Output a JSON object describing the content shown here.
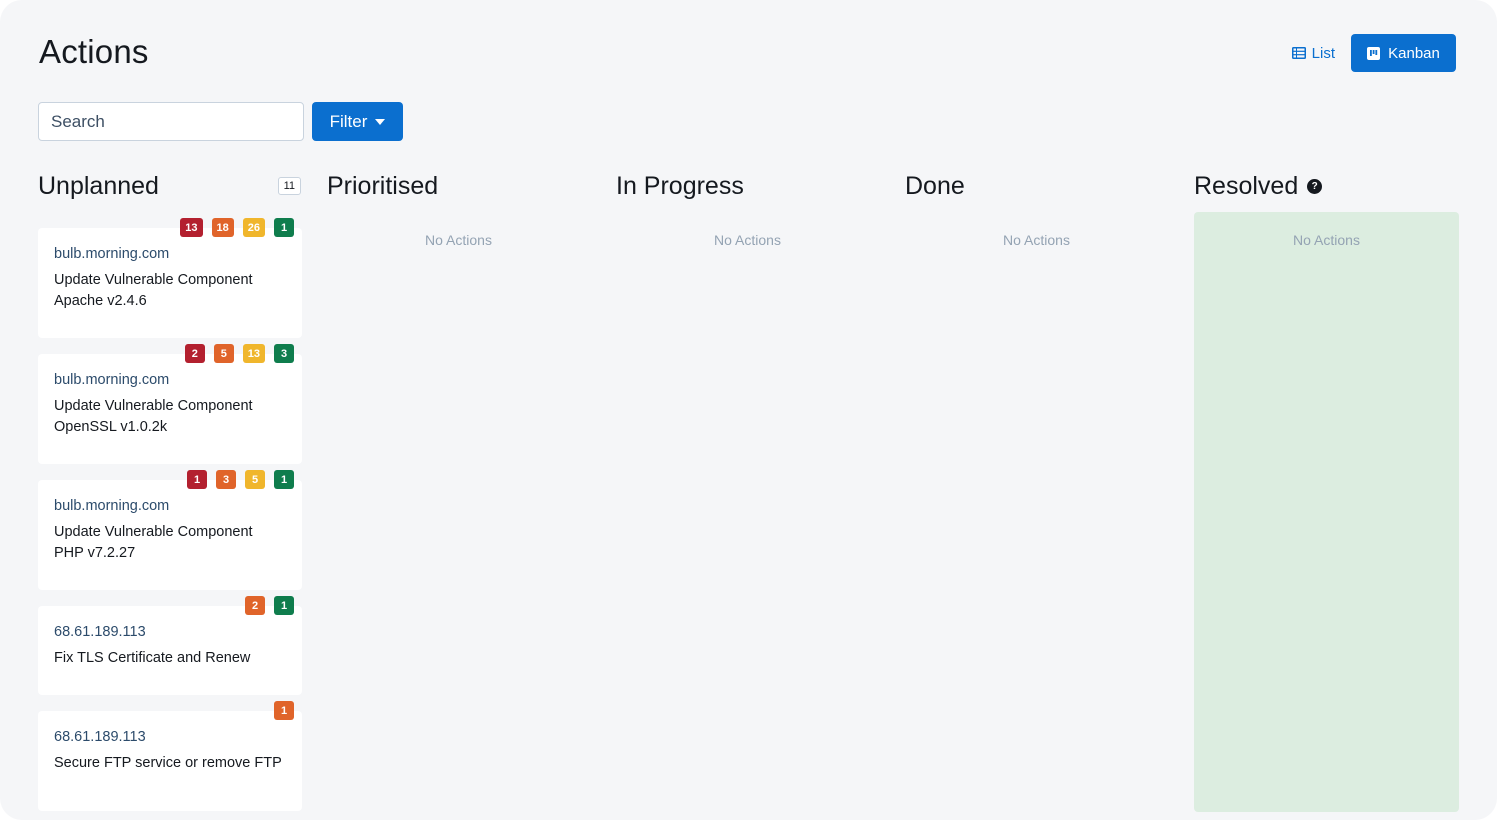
{
  "page": {
    "title": "Actions"
  },
  "view_switch": {
    "list_label": "List",
    "kanban_label": "Kanban",
    "active": "Kanban"
  },
  "toolbar": {
    "search_placeholder": "Search",
    "search_value": "",
    "filter_label": "Filter"
  },
  "colors": {
    "accent": "#0b6fcf",
    "critical": "#b3202f",
    "high": "#e0642a",
    "medium": "#f0b62c",
    "low": "#0f7d4d",
    "resolved_bg": "#dcede0"
  },
  "columns": [
    {
      "title": "Unplanned",
      "count": "11",
      "cards": [
        {
          "host": "bulb.morning.com",
          "title": "Update Vulnerable Component Apache v2.4.6",
          "badges": {
            "critical": "13",
            "high": "18",
            "medium": "26",
            "low": "1"
          }
        },
        {
          "host": "bulb.morning.com",
          "title": "Update Vulnerable Component OpenSSL v1.0.2k",
          "badges": {
            "critical": "2",
            "high": "5",
            "medium": "13",
            "low": "3"
          }
        },
        {
          "host": "bulb.morning.com",
          "title": "Update Vulnerable Component PHP v7.2.27",
          "badges": {
            "critical": "1",
            "high": "3",
            "medium": "5",
            "low": "1"
          }
        },
        {
          "host": "68.61.189.113",
          "title": "Fix TLS Certificate and Renew",
          "badges": {
            "high": "2",
            "low": "1"
          }
        },
        {
          "host": "68.61.189.113",
          "title": "Secure FTP service or remove FTP",
          "badges": {
            "high": "1"
          }
        }
      ]
    },
    {
      "title": "Prioritised",
      "empty_text": "No Actions"
    },
    {
      "title": "In Progress",
      "empty_text": "No Actions"
    },
    {
      "title": "Done",
      "empty_text": "No Actions"
    },
    {
      "title": "Resolved",
      "empty_text": "No Actions",
      "help_icon": "question-circle-icon"
    }
  ]
}
